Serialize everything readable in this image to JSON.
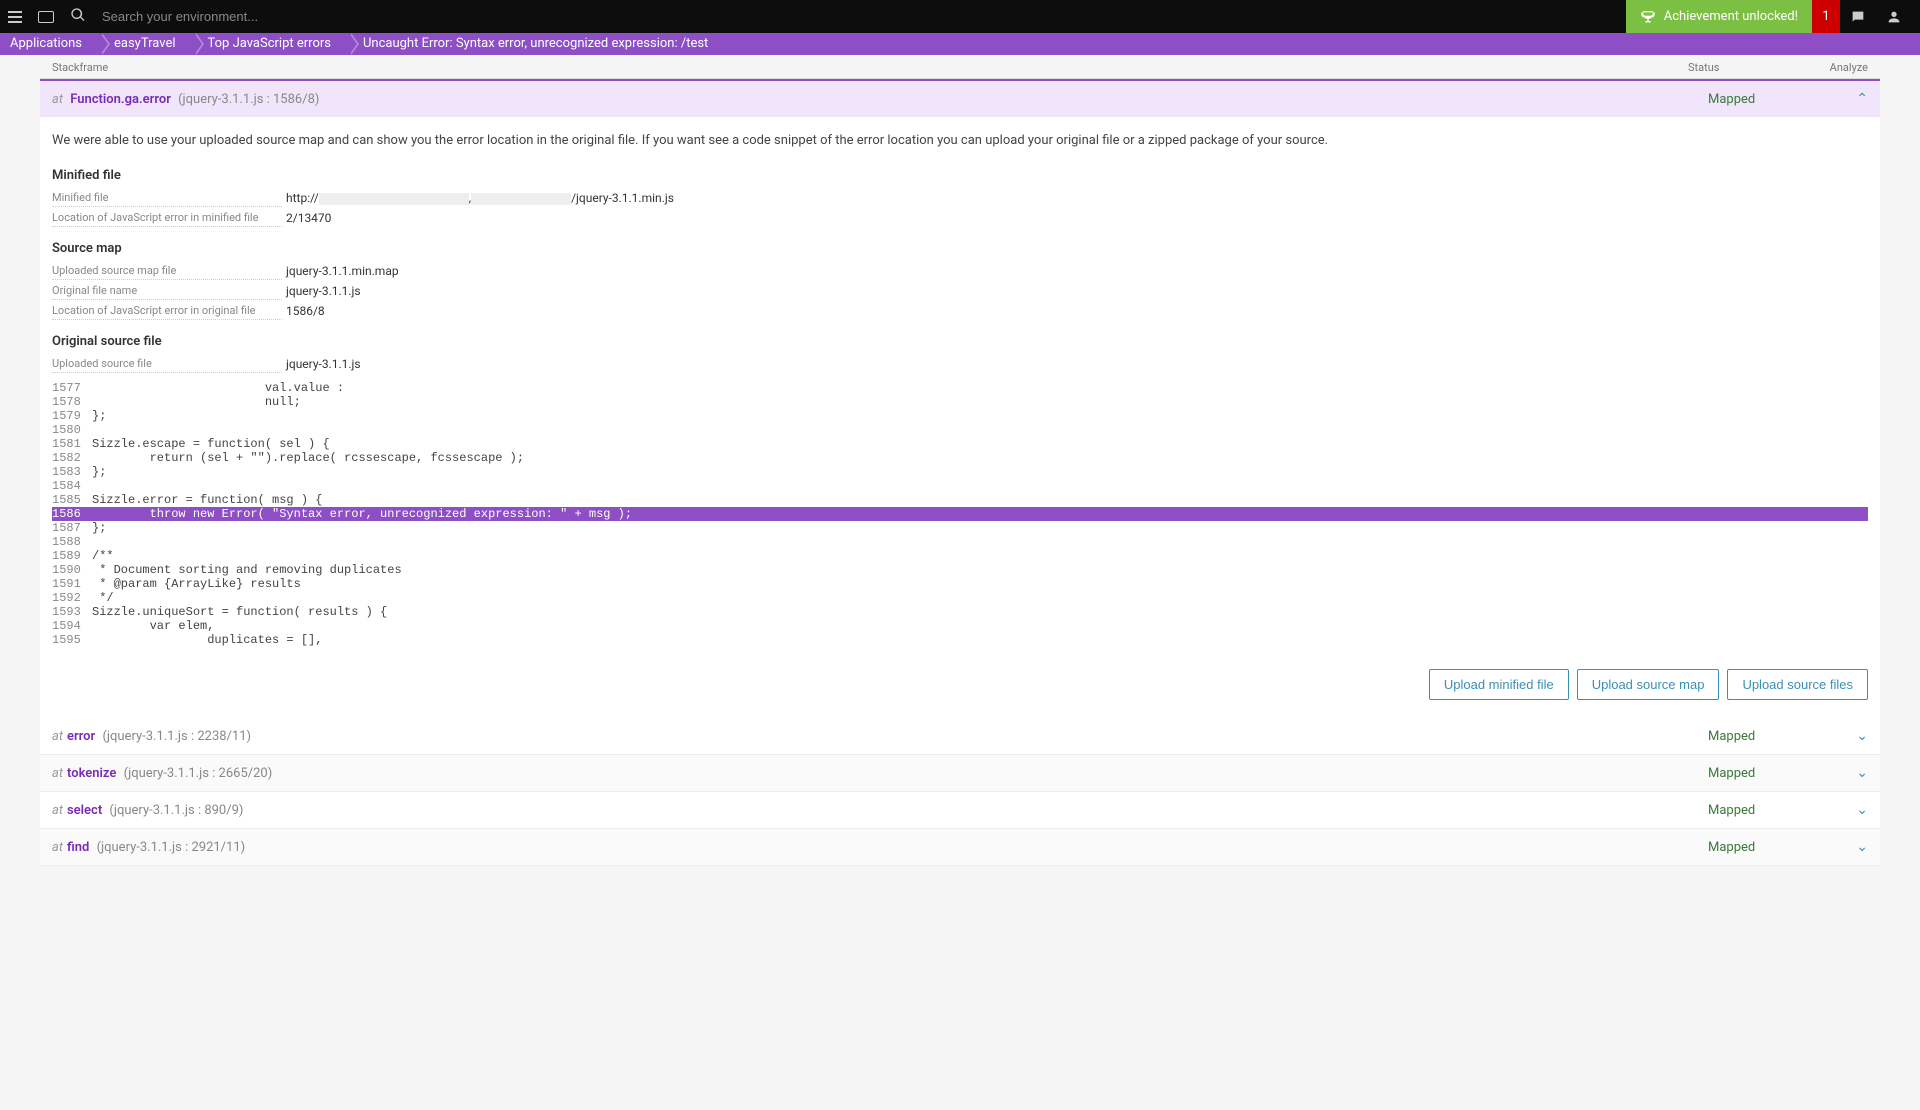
{
  "topbar": {
    "search_placeholder": "Search your environment...",
    "achievement_label": "Achievement unlocked!",
    "notification_count": "1"
  },
  "breadcrumb": [
    "Applications",
    "easyTravel",
    "Top JavaScript errors",
    "Uncaught Error: Syntax error, unrecognized expression: /test"
  ],
  "table_head": {
    "stack": "Stackframe",
    "status": "Status",
    "analyze": "Analyze"
  },
  "expanded_frame": {
    "at": "at",
    "fn": "Function.ga.error",
    "loc": "(jquery-3.1.1.js : 1586/8)",
    "status": "Mapped"
  },
  "intro": "We were able to use your uploaded source map and can show you the error location in the original file. If you want see a code snippet of the error location you can upload your original file or a zipped package of your source.",
  "minified": {
    "title": "Minified file",
    "rows": [
      {
        "k": "Minified file",
        "prefix": "http://",
        "suffix": "/jquery-3.1.1.min.js"
      },
      {
        "k": "Location of JavaScript error in minified file",
        "v": "2/13470"
      }
    ]
  },
  "sourcemap": {
    "title": "Source map",
    "rows": [
      {
        "k": "Uploaded source map file",
        "v": "jquery-3.1.1.min.map"
      },
      {
        "k": "Original file name",
        "v": "jquery-3.1.1.js"
      },
      {
        "k": "Location of JavaScript error in original file",
        "v": "1586/8"
      }
    ]
  },
  "original": {
    "title": "Original source file",
    "rows": [
      {
        "k": "Uploaded source file",
        "v": "jquery-3.1.1.js"
      }
    ]
  },
  "code": [
    {
      "ln": "1577",
      "t": "                        val.value :"
    },
    {
      "ln": "1578",
      "t": "                        null;"
    },
    {
      "ln": "1579",
      "t": "};"
    },
    {
      "ln": "1580",
      "t": ""
    },
    {
      "ln": "1581",
      "t": "Sizzle.escape = function( sel ) {"
    },
    {
      "ln": "1582",
      "t": "        return (sel + \"\").replace( rcssescape, fcssescape );"
    },
    {
      "ln": "1583",
      "t": "};"
    },
    {
      "ln": "1584",
      "t": ""
    },
    {
      "ln": "1585",
      "t": "Sizzle.error = function( msg ) {"
    },
    {
      "ln": "1586",
      "t": "        throw new Error( \"Syntax error, unrecognized expression: \" + msg );",
      "hl": true
    },
    {
      "ln": "1587",
      "t": "};"
    },
    {
      "ln": "1588",
      "t": ""
    },
    {
      "ln": "1589",
      "t": "/**"
    },
    {
      "ln": "1590",
      "t": " * Document sorting and removing duplicates"
    },
    {
      "ln": "1591",
      "t": " * @param {ArrayLike} results"
    },
    {
      "ln": "1592",
      "t": " */"
    },
    {
      "ln": "1593",
      "t": "Sizzle.uniqueSort = function( results ) {"
    },
    {
      "ln": "1594",
      "t": "        var elem,"
    },
    {
      "ln": "1595",
      "t": "                duplicates = [],"
    }
  ],
  "buttons": {
    "upload_minified": "Upload minified file",
    "upload_map": "Upload source map",
    "upload_source": "Upload source files"
  },
  "frames": [
    {
      "fn": "error",
      "loc": "(jquery-3.1.1.js : 2238/11)",
      "status": "Mapped"
    },
    {
      "fn": "tokenize",
      "loc": "(jquery-3.1.1.js : 2665/20)",
      "status": "Mapped"
    },
    {
      "fn": "select",
      "loc": "(jquery-3.1.1.js : 890/9)",
      "status": "Mapped"
    },
    {
      "fn": "find",
      "loc": "(jquery-3.1.1.js : 2921/11)",
      "status": "Mapped"
    }
  ]
}
